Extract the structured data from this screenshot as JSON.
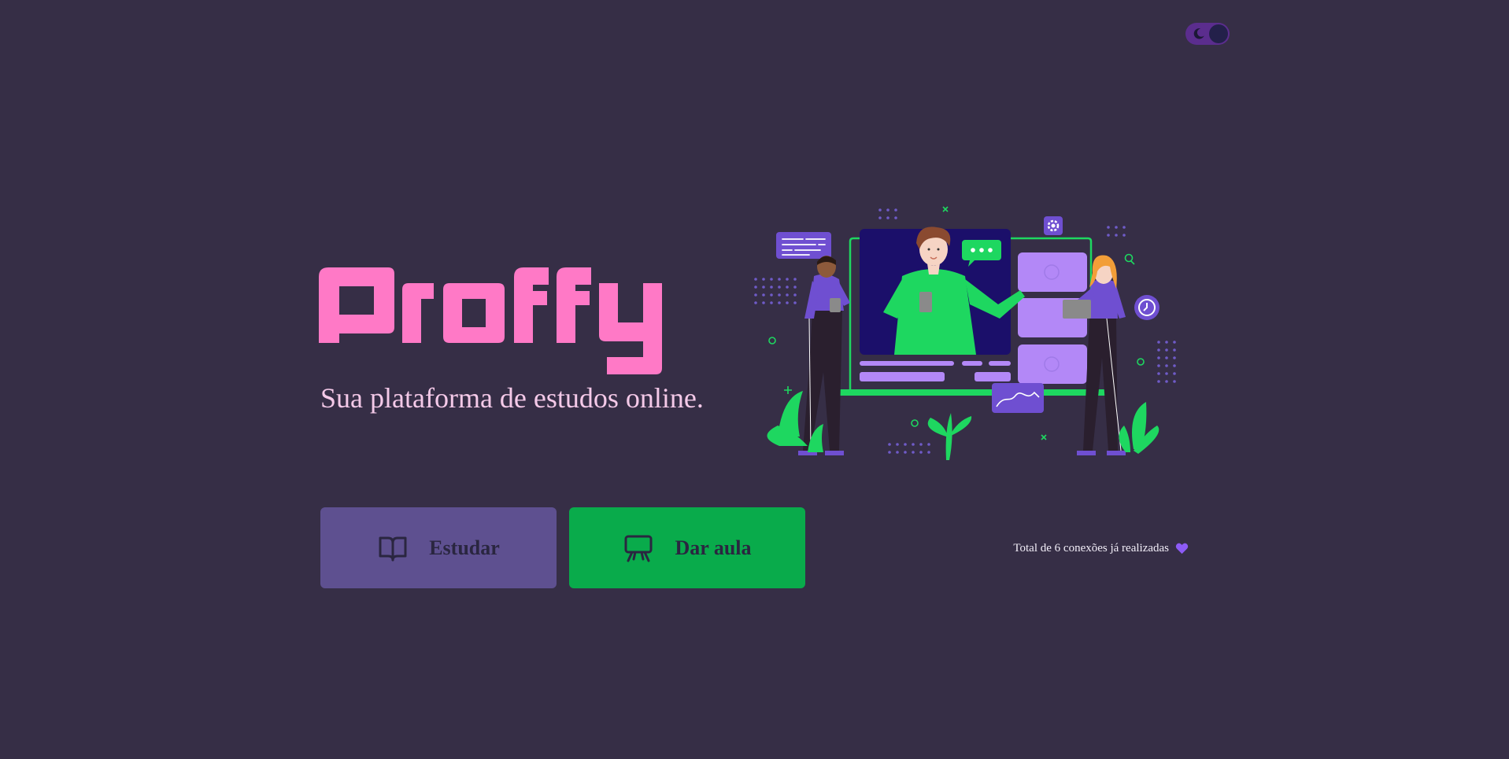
{
  "colors": {
    "background": "#362e46",
    "logo": "#ff79c6",
    "tagline": "#f4c9e8",
    "study_button": "#5e5090",
    "teach_button": "#09ab4b",
    "button_text": "#2a2640",
    "heart": "#8d5bf5",
    "toggle_track": "#5b2d8e"
  },
  "theme_toggle": {
    "icon": "moon-icon"
  },
  "logo": {
    "text": "Proffy"
  },
  "tagline": "Sua plataforma de estudos online.",
  "hero": {
    "icon": "online-class-illustration"
  },
  "buttons": {
    "study": {
      "label": "Estudar",
      "icon": "book-open-icon"
    },
    "teach": {
      "label": "Dar aula",
      "icon": "presentation-icon"
    }
  },
  "connections": {
    "text": "Total de 6 conexões já realizadas",
    "icon": "heart-icon"
  }
}
